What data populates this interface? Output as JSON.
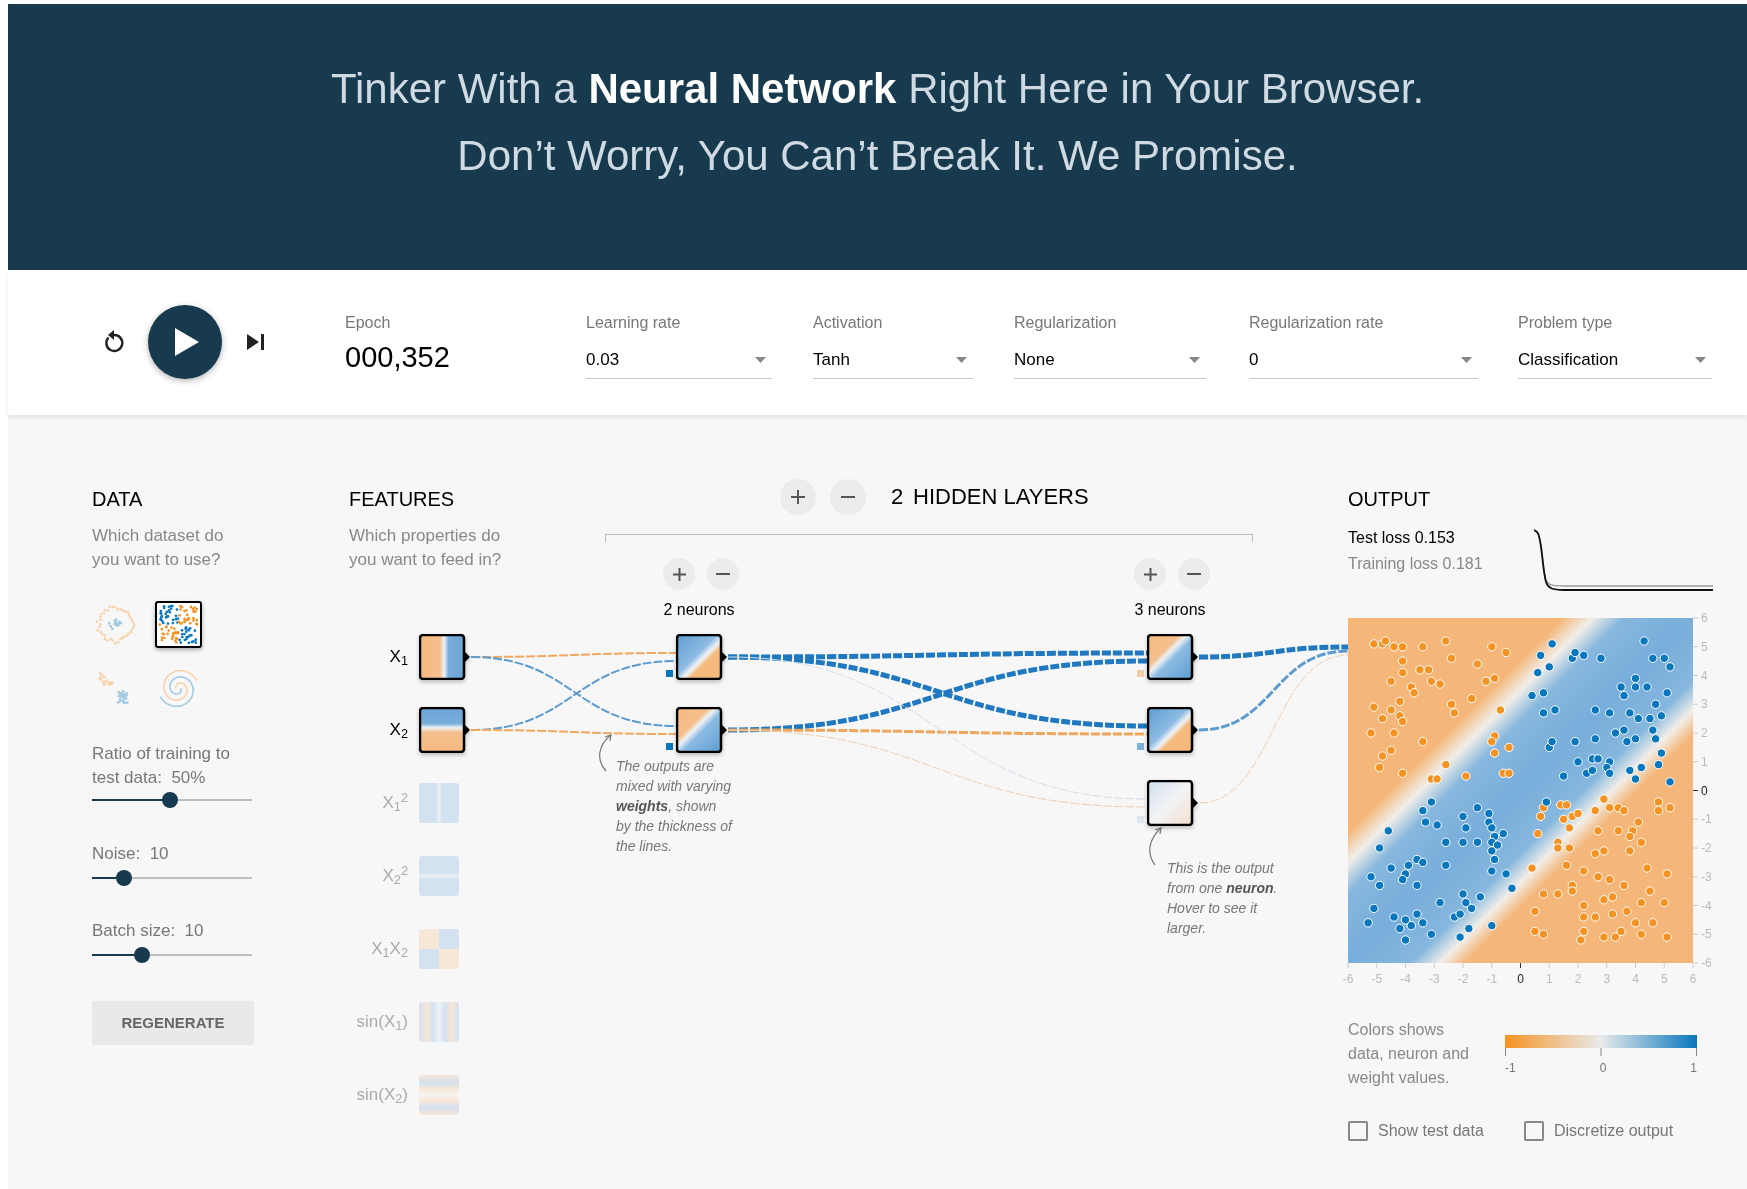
{
  "header": {
    "line_1": "Tinker With a **Neural Network** Right Here in Your Browser.",
    "line_2": "Don’t Worry, You Can’t Break It. We Promise."
  },
  "controls": {
    "epoch": {
      "label": "Epoch",
      "value": "000,352"
    },
    "dropdowns": [
      {
        "label": "Learning rate",
        "value": "0.03"
      },
      {
        "label": "Activation",
        "value": "Tanh"
      },
      {
        "label": "Regularization",
        "value": "None"
      },
      {
        "label": "Regularization rate",
        "value": "0"
      },
      {
        "label": "Problem type",
        "value": "Classification"
      }
    ]
  },
  "data": {
    "title": "DATA",
    "subtitle": "Which dataset do you want to use?",
    "datasets": [
      {
        "kind": "circle",
        "selected": false
      },
      {
        "kind": "xor",
        "selected": true
      },
      {
        "kind": "gauss",
        "selected": false
      },
      {
        "kind": "spiral",
        "selected": false
      }
    ],
    "sliders": [
      {
        "label": "Ratio of training to test data:  50%",
        "level": 0.49
      },
      {
        "label": "Noise:  10",
        "level": 0.2
      },
      {
        "label": "Batch size:  10",
        "level": 0.31
      }
    ],
    "regenerate": "REGENERATE"
  },
  "features": {
    "title": "FEATURES",
    "subtitle": "Which properties do you want to feed in?",
    "items": [
      {
        "label": "X$_{1}$",
        "kind": "x",
        "active": true
      },
      {
        "label": "X$_{2}$",
        "kind": "y",
        "active": true
      },
      {
        "label": "X$_{1}$$^{2}$",
        "kind": "x2",
        "active": false
      },
      {
        "label": "X$_{2}$$^{2}$",
        "kind": "y2",
        "active": false
      },
      {
        "label": "X$_{1}$X$_{2}$",
        "kind": "xy",
        "active": false
      },
      {
        "label": "sin(X$_{1}$)",
        "kind": "sinx",
        "active": false
      },
      {
        "label": "sin(X$_{2}$)",
        "kind": "siny",
        "active": false
      }
    ]
  },
  "network": {
    "layer_count": "2",
    "layers_label": "HIDDEN LAYERS",
    "layers": [
      {
        "neurons_label": "2 neurons",
        "neurons": [
          {
            "kind": "blue_orange",
            "color": "#0877bd",
            "in_links": [
              {
                "color": "#f0a860",
                "kind": "thin"
              },
              {
                "color": "#5b9bd0",
                "kind": "thin"
              }
            ]
          },
          {
            "kind": "orange_blue",
            "color": "#0877bd",
            "in_links": [
              {
                "color": "#5b9bd0",
                "kind": "thin"
              },
              {
                "color": "#f0a860",
                "kind": "thin"
              }
            ]
          }
        ]
      },
      {
        "neurons_label": "3 neurons",
        "neurons": [
          {
            "kind": "orange_blue",
            "color": "#f3cfa8",
            "in_links": [
              {
                "color": "#1f78c0",
                "kind": "thick"
              },
              {
                "color": "#1f78c0",
                "kind": "thick"
              }
            ]
          },
          {
            "kind": "blue_orange",
            "color": "#7fb0da",
            "in_links": [
              {
                "color": "#1f78c0",
                "kind": "thick"
              },
              {
                "color": "#eda65c",
                "kind": "medium"
              }
            ]
          },
          {
            "kind": "faint",
            "color": "#dce6ef",
            "in_links": [
              {
                "color": "#d3dfec",
                "kind": "faint"
              },
              {
                "color": "#f0cfae",
                "kind": "faint"
              }
            ]
          }
        ]
      }
    ],
    "out_links": [
      {
        "color": "#1f78c0",
        "kind": "thick"
      },
      {
        "color": "#5b9bd0",
        "kind": "medium"
      },
      {
        "color": "#f0cfae",
        "kind": "faint"
      }
    ],
    "annotations": [
      "The outputs are mixed with varying **weights**, shown by the thickness of the lines.",
      "This is the output from one **neuron**. Hover to see it larger."
    ]
  },
  "output": {
    "title": "OUTPUT",
    "test_loss": "Test loss 0.153",
    "training_loss": "Training loss 0.181",
    "chart_data": {
      "type": "scatter",
      "xlim": [
        -6,
        6
      ],
      "ylim": [
        -6,
        6
      ],
      "xticks": [
        {
          "value": -6,
          "label": "-6"
        },
        {
          "value": -5,
          "label": "-5"
        },
        {
          "value": -4,
          "label": "-4"
        },
        {
          "value": -3,
          "label": "-3"
        },
        {
          "value": -2,
          "label": "-2"
        },
        {
          "value": -1,
          "label": "-1"
        },
        {
          "value": 0,
          "label": "0"
        },
        {
          "value": 1,
          "label": "1"
        },
        {
          "value": 2,
          "label": "2"
        },
        {
          "value": 3,
          "label": "3"
        },
        {
          "value": 4,
          "label": "4"
        },
        {
          "value": 5,
          "label": "5"
        },
        {
          "value": 6,
          "label": "6"
        }
      ],
      "yticks": [
        {
          "value": -6,
          "label": "-6"
        },
        {
          "value": -5,
          "label": "-5"
        },
        {
          "value": -4,
          "label": "-4"
        },
        {
          "value": -3,
          "label": "-3"
        },
        {
          "value": -2,
          "label": "-2"
        },
        {
          "value": -1,
          "label": "-1"
        },
        {
          "value": 0,
          "label": "0"
        },
        {
          "value": 1,
          "label": "1"
        },
        {
          "value": 2,
          "label": "2"
        },
        {
          "value": 3,
          "label": "3"
        },
        {
          "value": 4,
          "label": "4"
        },
        {
          "value": 5,
          "label": "5"
        },
        {
          "value": 6,
          "label": "6"
        }
      ],
      "series": [
        {
          "color": "#f59322",
          "x": [
            -5.1,
            -4.8,
            -4.7,
            -4.4,
            -4.1,
            -3.4,
            -2.6,
            -2.4,
            -1.5,
            -1,
            -0.5,
            -4.1,
            -4.1,
            -3.5,
            -3.2,
            -4.5,
            -3.8,
            -3.7,
            -3.1,
            -2.8,
            -1.2,
            -0.9,
            -5.1,
            -4.2,
            -4.5,
            -4.2,
            -4.8,
            -4.1,
            -4.4,
            -5.2,
            -2.4,
            -2.3,
            -1.7,
            -0.7,
            -3.4,
            -4.5,
            -4.8,
            -4.9,
            -4.1,
            -2.6,
            -3.1,
            -2.9,
            -1.9,
            -0.9,
            -1,
            -0.9,
            -0.4,
            -0.6,
            -0.4,
            0.8,
            1.4,
            1.6,
            0.7,
            1.5,
            1.8,
            2.0,
            1.7,
            0.6,
            1.3,
            1.3,
            1.7,
            2.6,
            2.9,
            3.1,
            3.4,
            3.6,
            4.1,
            4.8,
            4.8,
            5.2,
            2.7,
            3.4,
            3.9,
            3.8,
            4.2,
            3.8,
            2.6,
            2.9,
            1.6,
            0.4,
            2.2,
            4.4,
            5.1,
            2.7,
            3.1,
            3.6,
            4.5,
            1.8,
            0.8,
            1.3,
            1.8,
            2.9,
            3.2,
            2.2,
            4.2,
            5,
            0.5,
            3.7,
            2.2,
            2.6,
            3.2,
            4,
            4.6,
            0.5,
            0.8,
            2.2,
            3.5,
            2.1,
            2.9,
            3.3,
            4.2,
            5.1
          ],
          "values": [
            5.1,
            5.1,
            5.2,
            5.0,
            5.0,
            5.0,
            5.2,
            4.6,
            4.4,
            5,
            4.8,
            4.5,
            4.1,
            4.2,
            4.2,
            3.8,
            3.6,
            3.4,
            3.8,
            3.7,
            3.8,
            3.9,
            2.9,
            3.1,
            2.8,
            2.6,
            2.5,
            2.4,
            2.0,
            2.0,
            3.0,
            2.7,
            3.2,
            2.8,
            1.7,
            1.4,
            1.2,
            0.8,
            0.6,
            0.9,
            0.4,
            0.4,
            0.5,
            1.9,
            1.7,
            1.3,
            1.5,
            0.6,
            0.6,
            -0.6,
            -0.5,
            -0.5,
            -0.9,
            -1.0,
            -0.9,
            -0.8,
            -1.3,
            -1.5,
            -1.8,
            -2.0,
            -2.0,
            -0.7,
            -0.3,
            -0.6,
            -0.6,
            -0.7,
            -1.1,
            -0.4,
            -0.7,
            -0.6,
            -1.4,
            -1.4,
            -1.4,
            -1.6,
            -1.8,
            -2.1,
            -2.2,
            -2.1,
            -2.6,
            -2.7,
            -2.8,
            -2.7,
            -2.9,
            -3.0,
            -3.1,
            -3.3,
            -3.5,
            -3.3,
            -3.6,
            -3.6,
            -3.5,
            -3.8,
            -3.7,
            -4.0,
            -3.9,
            -3.9,
            -4.2,
            -4.2,
            -4.4,
            -4.4,
            -4.3,
            -4.6,
            -4.6,
            -4.9,
            -5,
            -4.9,
            -4.9,
            -5.2,
            -5.1,
            -5.1,
            -5,
            -5.1
          ]
        },
        {
          "color": "#0877bd",
          "x": [
            1.1,
            0.7,
            0.6,
            1,
            1.8,
            1.9,
            2.2,
            2.8,
            4.3,
            4.6,
            5,
            5.2,
            4,
            3.5,
            3.6,
            4,
            4.4,
            5.1,
            0.4,
            0.8,
            0.8,
            1.2,
            2.6,
            3.1,
            3.8,
            4.1,
            4.5,
            4.9,
            4.7,
            3.3,
            3.6,
            3.7,
            4.0,
            4.6,
            4.7,
            1.0,
            1.1,
            1.9,
            2.6,
            2.0,
            2.5,
            2.7,
            3.1,
            3.0,
            2.3,
            2.5,
            3.1,
            1.5,
            3.8,
            4.2,
            4.8,
            4.0,
            5.2,
            4.9,
            0.9,
            -3.1,
            -3.4,
            -3.3,
            -2.9,
            -2,
            -1.5,
            -1.1,
            -1.1,
            -1,
            -0.6,
            -0.9,
            -1.5,
            -2.0,
            -2.6,
            -1.0,
            -0.8,
            -1,
            -1.9,
            -0.9,
            -4.6,
            -4.9,
            -3.6,
            -3.4,
            -2.6,
            -4.5,
            -3.9,
            -4.0,
            -4.1,
            -5.2,
            -4.9,
            -3.6,
            -1.0,
            -0.5,
            -0.3,
            -2,
            -1.9,
            -1.7,
            -1.4,
            -2.8,
            -5.1,
            -4.4,
            -4.0,
            -3.6,
            -3.4,
            -5.3,
            -4.2,
            -3.8,
            -2.3,
            -2.1,
            -1.8,
            -1,
            -3.1,
            -4.0,
            -2.1
          ],
          "values": [
            5.1,
            4.7,
            4.1,
            4.3,
            4.6,
            4.8,
            4.7,
            4.6,
            5.2,
            4.6,
            4.6,
            4.3,
            3.9,
            3.6,
            3.3,
            3.6,
            3.6,
            3.4,
            3.3,
            3.4,
            2.7,
            2.8,
            2.8,
            2.7,
            2.7,
            2.5,
            2.5,
            2.6,
            3.0,
            2.0,
            2.1,
            1.7,
            1.8,
            2.1,
            1.8,
            1.5,
            1.7,
            1.7,
            1.8,
            1.0,
            1.1,
            1.1,
            1.0,
            0.8,
            0.6,
            0.7,
            0.6,
            0.5,
            0.7,
            0.8,
            0.9,
            0.4,
            0.3,
            1.3,
            -0.4,
            -0.4,
            -0.7,
            -1.1,
            -1.2,
            -0.9,
            -0.6,
            -0.8,
            -1.1,
            -1.3,
            -1.5,
            -1.6,
            -1.8,
            -1.8,
            -1.8,
            -1.8,
            -1.9,
            -2.1,
            -1.3,
            -2.4,
            -1.4,
            -2.0,
            -2.4,
            -2.5,
            -2.6,
            -2.7,
            -2.6,
            -2.9,
            -3.1,
            -3.0,
            -3.3,
            -3.3,
            -2.8,
            -2.9,
            -3.4,
            -3.6,
            -3.9,
            -4.1,
            -3.7,
            -3.9,
            -4.1,
            -4.4,
            -4.5,
            -4.3,
            -4.6,
            -4.6,
            -4.8,
            -4.7,
            -4.4,
            -4.3,
            -4.8,
            -4.7,
            -5.0,
            -5.2,
            -5.1
          ]
        }
      ]
    },
    "legend": {
      "text": "Colors shows data, neuron and weight values.",
      "ticks": [
        "-1",
        "0",
        "1"
      ]
    },
    "checkboxes": [
      {
        "label": "Show test data",
        "checked": false
      },
      {
        "label": "Discretize output",
        "checked": false
      }
    ]
  }
}
